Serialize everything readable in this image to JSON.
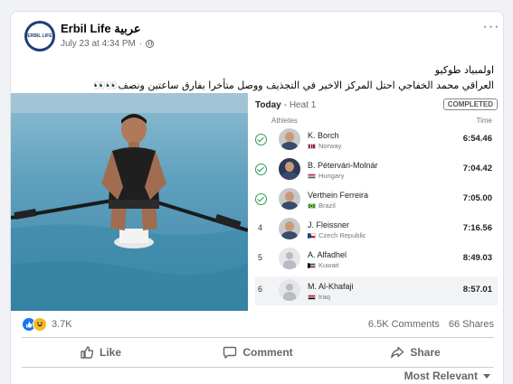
{
  "post": {
    "page_name": "Erbil Life عربية",
    "avatar_text": "ERBIL LIFE",
    "timestamp": "July 23 at 4:34 PM",
    "separator": "·",
    "more_icon": "ellipsis-icon",
    "text_line1": "اولمبياد طوكيو",
    "text_line2": "العراقي محمد الخفاجي احتل المركز الاخير في التجذيف ووصل متأخرا بفارق ساعتين ونصف👀👀"
  },
  "results": {
    "title": "Today",
    "heat": "- Heat 1",
    "badge": "COMPLETED",
    "col_athletes": "Athletes",
    "col_time": "Time",
    "rows": [
      {
        "rank": "",
        "status": "qualified",
        "name": "K. Borch",
        "country": "Norway",
        "time": "6:54.46",
        "flag": [
          "#ba0c2f",
          "#ffffff",
          "#00205b"
        ]
      },
      {
        "rank": "",
        "status": "qualified",
        "name": "B. Pétervári-Molnár",
        "country": "Hungary",
        "time": "7:04.42",
        "flag": [
          "#ce2939",
          "#ffffff",
          "#477050"
        ]
      },
      {
        "rank": "",
        "status": "qualified",
        "name": "Verthein Ferreira",
        "country": "Brazil",
        "time": "7:05.00",
        "flag": [
          "#009c3b",
          "#ffdf00",
          "#002776"
        ]
      },
      {
        "rank": "4",
        "status": "",
        "name": "J. Fleissner",
        "country": "Czech Republic",
        "time": "7:16.56",
        "flag": [
          "#ffffff",
          "#d7141a",
          "#11457e"
        ]
      },
      {
        "rank": "5",
        "status": "",
        "name": "A. Alfadhel",
        "country": "Kuwait",
        "time": "8:49.03",
        "flag": [
          "#007a3d",
          "#ffffff",
          "#ce1126"
        ]
      },
      {
        "rank": "6",
        "status": "",
        "name": "M. Al-Khafaji",
        "country": "Iraq",
        "time": "8:57.01",
        "flag": [
          "#ce1126",
          "#ffffff",
          "#000000"
        ]
      }
    ]
  },
  "stats": {
    "reaction_count": "3.7K",
    "comments": "6.5K Comments",
    "shares": "66 Shares",
    "reaction_icons": [
      "like-reaction-icon",
      "haha-reaction-icon"
    ]
  },
  "actions": {
    "like": "Like",
    "comment": "Comment",
    "share": "Share"
  },
  "sort": {
    "label": "Most Relevant"
  },
  "colors": {
    "accent": "#1877f2",
    "muted": "#65676b",
    "qualified": "#2e9b4f"
  }
}
